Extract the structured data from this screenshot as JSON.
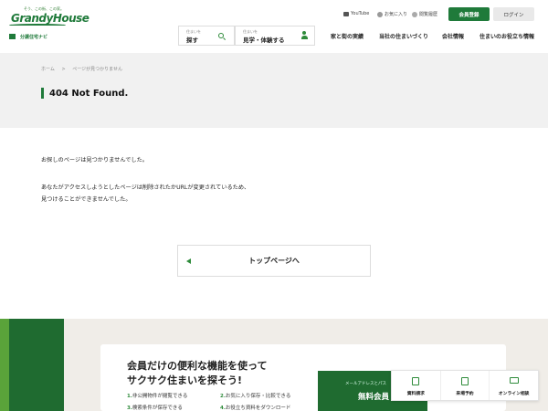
{
  "header": {
    "logo": {
      "tagline": "そう、この街、この家。",
      "brand": "GrandyHouse",
      "sub": "分譲住宅ナビ"
    },
    "util": {
      "youtube": "YouTube",
      "favorites": "お気に入り",
      "history": "閲覧履歴",
      "member_button": "会員登録",
      "login_button": "ログイン"
    },
    "search": {
      "small": "住まいを",
      "big": "探す"
    },
    "visit": {
      "small": "住まいを",
      "big": "見学・体験する"
    },
    "nav": [
      "家と街の実績",
      "当社の住まいづくり",
      "会社情報",
      "住まいのお役立ち情報"
    ]
  },
  "breadcrumb": {
    "home": "ホーム",
    "separator": ">",
    "current": "ページが見つかりません"
  },
  "page_title": "404 Not Found.",
  "messages": {
    "line1": "お探しのページは見つかりませんでした。",
    "line2": "あなたがアクセスしようとしたページは削除されたかURLが変更されているため、",
    "line3": "見つけることができませんでした。"
  },
  "top_button": "トップページへ",
  "promo": {
    "heading1": "会員だけの便利な機能を使って",
    "heading2": "サクサク住まいを探そう!",
    "features": [
      {
        "num": "1.",
        "text": "非公開物件が閲覧できる"
      },
      {
        "num": "2.",
        "text": "お気に入り保存・比較できる"
      },
      {
        "num": "3.",
        "text": "検索条件が保存できる"
      },
      {
        "num": "4.",
        "text": "お役立ち資料をダウンロード"
      }
    ],
    "register_small": "メールアドレスとパス",
    "register_big": "無料会員"
  },
  "floating_bar": [
    {
      "label": "資料請求",
      "icon": "document-icon"
    },
    {
      "label": "来場予約",
      "icon": "calendar-icon"
    },
    {
      "label": "オンライン相談",
      "icon": "monitor-icon"
    }
  ],
  "colors": {
    "brand_green": "#1f7a3a",
    "accent_green": "#2e8b3a",
    "band_gray": "#f1f1f1"
  }
}
